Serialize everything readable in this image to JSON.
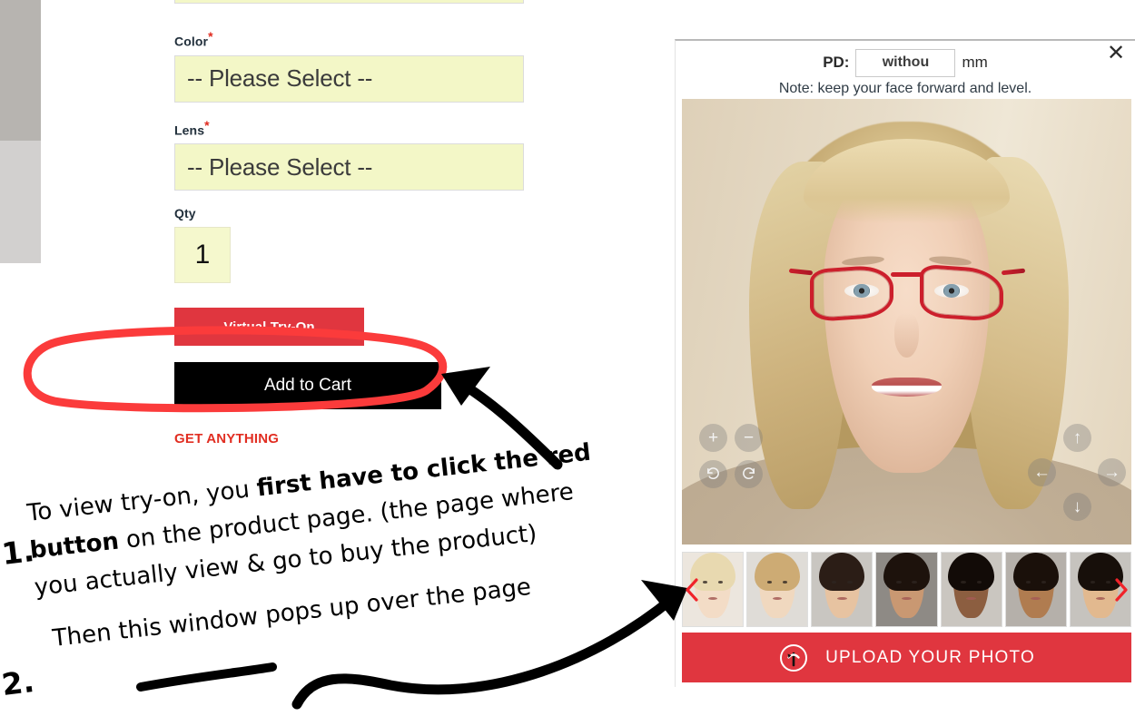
{
  "product_form": {
    "fields": [
      {
        "label": "Color",
        "required": true,
        "value": "-- Please Select --"
      },
      {
        "label": "Lens",
        "required": true,
        "value": "-- Please Select --"
      },
      {
        "label": "Qty",
        "required": false,
        "value": "1"
      }
    ],
    "required_marker": "*",
    "buttons": {
      "virtual_try_on": "Virtual Try-On",
      "add_to_cart": "Add to Cart"
    },
    "promo_text": "GET ANYTHING"
  },
  "tryon_modal": {
    "pd_label": "PD:",
    "pd_value": "withou",
    "pd_placeholder": "without",
    "pd_unit": "mm",
    "note": "Note: keep your face forward and level.",
    "close_label": "✕",
    "photo_controls": {
      "zoom_in": "+",
      "zoom_out": "−",
      "rotate_ccw": "rotate-counterclockwise",
      "rotate_cw": "rotate-clockwise",
      "move_up": "↑",
      "move_left": "←",
      "move_right": "→",
      "move_down": "↓"
    },
    "thumbnails": [
      {
        "name": "model-1",
        "selected": true,
        "skin": "#f3dcc6",
        "hair": "#e8d9b0",
        "bg": "#ece6de"
      },
      {
        "name": "model-2",
        "selected": false,
        "skin": "#f0d8bf",
        "hair": "#cdab74",
        "bg": "#dfdcd7"
      },
      {
        "name": "model-3",
        "selected": false,
        "skin": "#e7c3a1",
        "hair": "#2b1d16",
        "bg": "#c9c6c1"
      },
      {
        "name": "model-4",
        "selected": false,
        "skin": "#c99872",
        "hair": "#1d120c",
        "bg": "#8e8a85"
      },
      {
        "name": "model-5",
        "selected": false,
        "skin": "#8c5e40",
        "hair": "#120b07",
        "bg": "#cac6c0"
      },
      {
        "name": "model-6",
        "selected": false,
        "skin": "#b07c50",
        "hair": "#1a100a",
        "bg": "#b5b0aa"
      },
      {
        "name": "model-7",
        "selected": false,
        "skin": "#e2b98f",
        "hair": "#170f0a",
        "bg": "#c6c3be"
      }
    ],
    "prev_arrow": "chevron-left",
    "next_arrow": "chevron-right",
    "upload_button": "UPLOAD YOUR PHOTO"
  },
  "annotations": {
    "step1_number": "1.",
    "step2_number": "2.",
    "line1_a": "To view try-on, you ",
    "line1_b": "first have to click the red",
    "line2_a": "button",
    "line2_b": " on the product page.  (the page where",
    "line3": "you actually view & go to buy the product)",
    "line4": "Then this window pops up over the page",
    "ellipse_color": "#fb3b3b",
    "arrow_color": "#000000"
  },
  "colors": {
    "accent_red": "#e0363f",
    "select_yellow": "#f3f7c7",
    "cart_black": "#000000",
    "required_red": "#e02b1f"
  }
}
